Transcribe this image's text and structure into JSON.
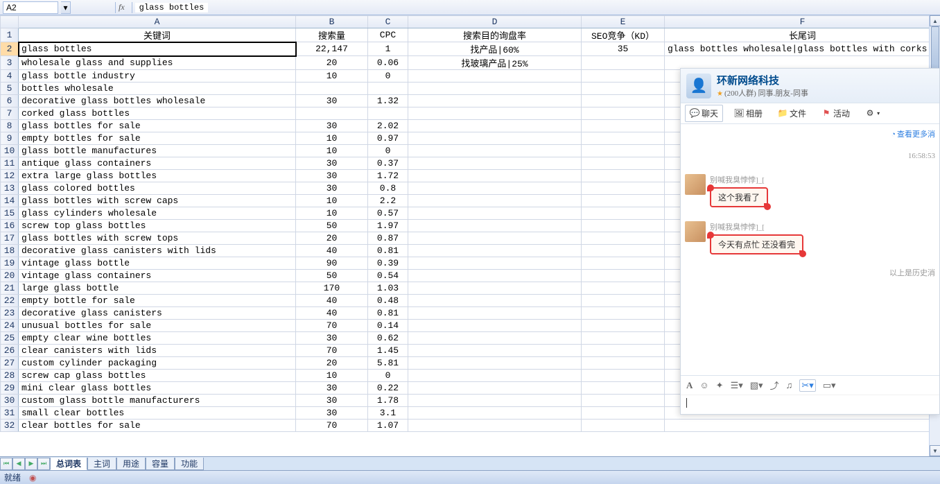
{
  "formula_bar": {
    "name_box": "A2",
    "fx_label": "fx",
    "formula": "glass bottles"
  },
  "columns": [
    "A",
    "B",
    "C",
    "D",
    "E",
    "F"
  ],
  "headers": {
    "A": "关键词",
    "B": "搜索量",
    "C": "CPC",
    "D": "搜索目的询盘率",
    "E": "SEO竞争（KD）",
    "F": "长尾词"
  },
  "rows": [
    {
      "n": 2,
      "A": "glass bottles",
      "B": "22,147",
      "C": "1",
      "D": "找产品|60%",
      "E": "35",
      "F": "glass bottles wholesale|glass bottles with corks"
    },
    {
      "n": 3,
      "A": "wholesale glass and supplies",
      "B": "20",
      "C": "0.06",
      "D": "找玻璃产品|25%",
      "E": "",
      "F": ""
    },
    {
      "n": 4,
      "A": "glass bottle industry",
      "B": "10",
      "C": "0",
      "D": "",
      "E": "",
      "F": ""
    },
    {
      "n": 5,
      "A": "bottles wholesale",
      "B": "",
      "C": "",
      "D": "",
      "E": "",
      "F": ""
    },
    {
      "n": 6,
      "A": "decorative glass bottles wholesale",
      "B": "30",
      "C": "1.32",
      "D": "",
      "E": "",
      "F": ""
    },
    {
      "n": 7,
      "A": "corked glass bottles",
      "B": "",
      "C": "",
      "D": "",
      "E": "",
      "F": ""
    },
    {
      "n": 8,
      "A": "glass bottles for sale",
      "B": "30",
      "C": "2.02",
      "D": "",
      "E": "",
      "F": ""
    },
    {
      "n": 9,
      "A": "empty bottles for sale",
      "B": "10",
      "C": "0.97",
      "D": "",
      "E": "",
      "F": ""
    },
    {
      "n": 10,
      "A": "glass bottle manufactures",
      "B": "10",
      "C": "0",
      "D": "",
      "E": "",
      "F": ""
    },
    {
      "n": 11,
      "A": "antique glass containers",
      "B": "30",
      "C": "0.37",
      "D": "",
      "E": "",
      "F": ""
    },
    {
      "n": 12,
      "A": "extra large glass bottles",
      "B": "30",
      "C": "1.72",
      "D": "",
      "E": "",
      "F": ""
    },
    {
      "n": 13,
      "A": "glass colored bottles",
      "B": "30",
      "C": "0.8",
      "D": "",
      "E": "",
      "F": ""
    },
    {
      "n": 14,
      "A": "glass bottles with screw caps",
      "B": "10",
      "C": "2.2",
      "D": "",
      "E": "",
      "F": ""
    },
    {
      "n": 15,
      "A": "glass cylinders wholesale",
      "B": "10",
      "C": "0.57",
      "D": "",
      "E": "",
      "F": ""
    },
    {
      "n": 16,
      "A": "screw top glass bottles",
      "B": "50",
      "C": "1.97",
      "D": "",
      "E": "",
      "F": ""
    },
    {
      "n": 17,
      "A": "glass bottles with screw tops",
      "B": "20",
      "C": "0.87",
      "D": "",
      "E": "",
      "F": ""
    },
    {
      "n": 18,
      "A": "decorative glass canisters with lids",
      "B": "40",
      "C": "0.81",
      "D": "",
      "E": "",
      "F": ""
    },
    {
      "n": 19,
      "A": "vintage glass bottle",
      "B": "90",
      "C": "0.39",
      "D": "",
      "E": "",
      "F": ""
    },
    {
      "n": 20,
      "A": "vintage glass containers",
      "B": "50",
      "C": "0.54",
      "D": "",
      "E": "",
      "F": ""
    },
    {
      "n": 21,
      "A": "large glass bottle",
      "B": "170",
      "C": "1.03",
      "D": "",
      "E": "",
      "F": ""
    },
    {
      "n": 22,
      "A": "empty bottle for sale",
      "B": "40",
      "C": "0.48",
      "D": "",
      "E": "",
      "F": ""
    },
    {
      "n": 23,
      "A": "decorative glass canisters",
      "B": "40",
      "C": "0.81",
      "D": "",
      "E": "",
      "F": ""
    },
    {
      "n": 24,
      "A": "unusual bottles for sale",
      "B": "70",
      "C": "0.14",
      "D": "",
      "E": "",
      "F": ""
    },
    {
      "n": 25,
      "A": "empty clear wine bottles",
      "B": "30",
      "C": "0.62",
      "D": "",
      "E": "",
      "F": ""
    },
    {
      "n": 26,
      "A": "clear canisters with lids",
      "B": "70",
      "C": "1.45",
      "D": "",
      "E": "",
      "F": ""
    },
    {
      "n": 27,
      "A": "custom cylinder packaging",
      "B": "20",
      "C": "5.81",
      "D": "",
      "E": "",
      "F": ""
    },
    {
      "n": 28,
      "A": "screw cap glass bottles",
      "B": "10",
      "C": "0",
      "D": "",
      "E": "",
      "F": ""
    },
    {
      "n": 29,
      "A": "mini clear glass bottles",
      "B": "30",
      "C": "0.22",
      "D": "",
      "E": "",
      "F": ""
    },
    {
      "n": 30,
      "A": "custom glass bottle manufacturers",
      "B": "30",
      "C": "1.78",
      "D": "",
      "E": "",
      "F": ""
    },
    {
      "n": 31,
      "A": "small clear bottles",
      "B": "30",
      "C": "3.1",
      "D": "",
      "E": "",
      "F": ""
    },
    {
      "n": 32,
      "A": "clear bottles for sale",
      "B": "70",
      "C": "1.07",
      "D": "",
      "E": "",
      "F": ""
    }
  ],
  "sheet_tabs": [
    "总词表",
    "主词",
    "用途",
    "容量",
    "功能"
  ],
  "active_sheet": "总词表",
  "status_bar": {
    "ready": "就绪"
  },
  "chat": {
    "title": "环新网络科技",
    "subtitle_prefix": "(200人群)",
    "subtitle_rest": " 同事.朋友-同事",
    "tabs": [
      "聊天",
      "相册",
      "文件",
      "活动"
    ],
    "more": "查看更多消",
    "time": "16:58:53",
    "nick": "别喊我臭悖悖]_[",
    "msg1": "这个我看了",
    "msg2": "今天有点忙  还没看完",
    "history": "以上是历史消"
  }
}
